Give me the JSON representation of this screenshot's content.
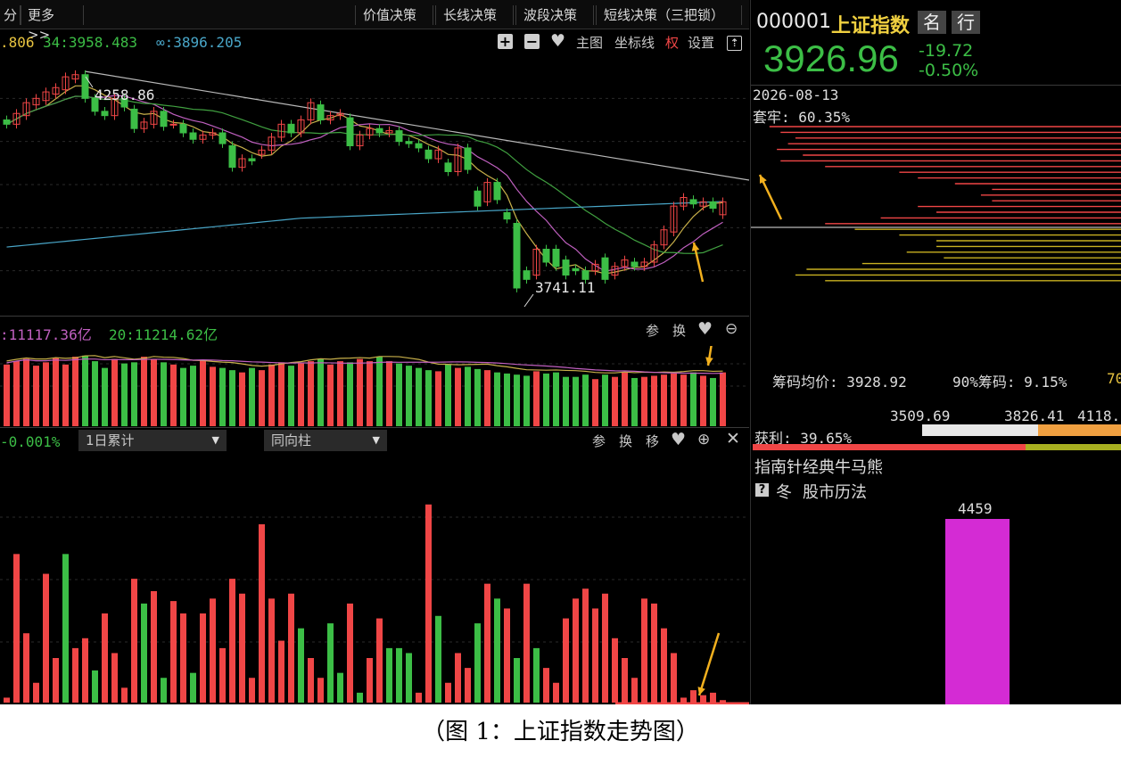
{
  "colors": {
    "up": "#f04646",
    "down": "#3cbe46",
    "bg": "#000000",
    "ma5": "#c8b04a",
    "ma10": "#c060c0",
    "ma20": "#40a040",
    "ma250": "#49a6c8",
    "trend": "#b8b8b8",
    "arrow": "#f2b01e",
    "magenta": "#d42bd4",
    "gold": "#f0d040"
  },
  "toolbar": {
    "left_stub": "分",
    "more_label": "更多>>",
    "tabs": [
      "价值决策",
      "长线决策",
      "波段决策",
      "短线决策（三把锁）"
    ]
  },
  "ma_legend": {
    "a": ".806",
    "b": "34:3958.483",
    "c": "∞:3896.205"
  },
  "chart_tools": {
    "zoom_in": "+",
    "zoom_out": "−",
    "heart": "♥",
    "main": "主图",
    "axis": "坐标线",
    "quan": "权",
    "settings": "设置",
    "export": "⇡"
  },
  "price_labels": {
    "high": "4258.86",
    "low": "3741.11"
  },
  "vol_legend": {
    "a": ":11117.36亿",
    "b": "20:11214.62亿"
  },
  "vol_tools": {
    "can": "参",
    "huan": "换"
  },
  "ind_panel": {
    "value": "-0.001%",
    "select1": "1日累计",
    "select2": "同向柱",
    "can": "参",
    "huan": "换",
    "yi": "移"
  },
  "quote": {
    "code": "000001",
    "name": "上证指数",
    "btn_ming": "名",
    "btn_hang": "行",
    "price": "3926.96",
    "change": "-19.72",
    "pct": "-0.50%"
  },
  "chip": {
    "date": "2026-08-13",
    "trapped": "套牢: 60.35%",
    "avg_label": "筹码均价: 3928.92",
    "ratio90": "90%筹码: 9.15%",
    "ratio70_cut": "70",
    "range_a": "3509.69",
    "range_b": "3826.41",
    "range_c": "4118.",
    "profit": "获利: 39.65%"
  },
  "bull_bear": {
    "title": "指南针经典牛马熊",
    "help": "?",
    "season": "冬",
    "method": "股市历法",
    "bar_value": "4459"
  },
  "caption": "（图 1：上证指数走势图）",
  "chart_data": {
    "type": "candlestick",
    "series": [
      {
        "o": 4150,
        "c": 4140
      },
      {
        "o": 4140,
        "c": 4165
      },
      {
        "o": 4160,
        "c": 4190
      },
      {
        "o": 4185,
        "c": 4200
      },
      {
        "o": 4195,
        "c": 4215
      },
      {
        "o": 4210,
        "c": 4225
      },
      {
        "o": 4220,
        "c": 4250
      },
      {
        "o": 4245,
        "c": 4255
      },
      {
        "o": 4255,
        "c": 4200
      },
      {
        "o": 4200,
        "c": 4170
      },
      {
        "o": 4170,
        "c": 4160
      },
      {
        "o": 4160,
        "c": 4200
      },
      {
        "o": 4200,
        "c": 4180
      },
      {
        "o": 4175,
        "c": 4130
      },
      {
        "o": 4130,
        "c": 4145
      },
      {
        "o": 4140,
        "c": 4170
      },
      {
        "o": 4170,
        "c": 4135
      },
      {
        "o": 4140,
        "c": 4140
      },
      {
        "o": 4140,
        "c": 4120
      },
      {
        "o": 4120,
        "c": 4105
      },
      {
        "o": 4105,
        "c": 4115
      },
      {
        "o": 4115,
        "c": 4120
      },
      {
        "o": 4120,
        "c": 4095
      },
      {
        "o": 4090,
        "c": 4040
      },
      {
        "o": 4040,
        "c": 4060
      },
      {
        "o": 4060,
        "c": 4055
      },
      {
        "o": 4070,
        "c": 4080
      },
      {
        "o": 4080,
        "c": 4110
      },
      {
        "o": 4110,
        "c": 4140
      },
      {
        "o": 4140,
        "c": 4120
      },
      {
        "o": 4120,
        "c": 4150
      },
      {
        "o": 4150,
        "c": 4190
      },
      {
        "o": 4185,
        "c": 4150
      },
      {
        "o": 4150,
        "c": 4160
      },
      {
        "o": 4160,
        "c": 4165
      },
      {
        "o": 4155,
        "c": 4090
      },
      {
        "o": 4090,
        "c": 4115
      },
      {
        "o": 4115,
        "c": 4130
      },
      {
        "o": 4130,
        "c": 4120
      },
      {
        "o": 4120,
        "c": 4125
      },
      {
        "o": 4125,
        "c": 4100
      },
      {
        "o": 4100,
        "c": 4095
      },
      {
        "o": 4095,
        "c": 4085
      },
      {
        "o": 4080,
        "c": 4060
      },
      {
        "o": 4060,
        "c": 4080
      },
      {
        "o": 4050,
        "c": 4030
      },
      {
        "o": 4030,
        "c": 4085
      },
      {
        "o": 4085,
        "c": 4035
      },
      {
        "o": 3985,
        "c": 3950
      },
      {
        "o": 3960,
        "c": 4005
      },
      {
        "o": 4005,
        "c": 3965
      },
      {
        "o": 3935,
        "c": 3920
      },
      {
        "o": 3910,
        "c": 3760
      },
      {
        "o": 3800,
        "c": 3780
      },
      {
        "o": 3790,
        "c": 3850
      },
      {
        "o": 3850,
        "c": 3820
      },
      {
        "o": 3850,
        "c": 3810
      },
      {
        "o": 3825,
        "c": 3790
      },
      {
        "o": 3805,
        "c": 3800
      },
      {
        "o": 3800,
        "c": 3780
      },
      {
        "o": 3800,
        "c": 3815
      },
      {
        "o": 3830,
        "c": 3780
      },
      {
        "o": 3790,
        "c": 3810
      },
      {
        "o": 3810,
        "c": 3825
      },
      {
        "o": 3820,
        "c": 3810
      },
      {
        "o": 3810,
        "c": 3820
      },
      {
        "o": 3820,
        "c": 3860
      },
      {
        "o": 3860,
        "c": 3895
      },
      {
        "o": 3890,
        "c": 3950
      },
      {
        "o": 3950,
        "c": 3970
      },
      {
        "o": 3965,
        "c": 3955
      },
      {
        "o": 3950,
        "c": 3960
      },
      {
        "o": 3960,
        "c": 3945
      },
      {
        "o": 3930,
        "c": 3960
      }
    ],
    "volume": [
      55,
      58,
      60,
      54,
      57,
      61,
      55,
      62,
      63,
      58,
      52,
      60,
      56,
      57,
      62,
      60,
      57,
      55,
      52,
      54,
      59,
      53,
      52,
      50,
      48,
      52,
      50,
      55,
      57,
      54,
      56,
      58,
      60,
      55,
      58,
      57,
      60,
      58,
      62,
      58,
      56,
      54,
      52,
      50,
      49,
      55,
      52,
      53,
      51,
      50,
      48,
      47,
      46,
      45,
      49,
      47,
      48,
      44,
      44,
      46,
      42,
      46,
      44,
      48,
      43,
      44,
      45,
      46,
      47,
      46,
      48,
      45,
      43,
      48
    ],
    "volume_up": [
      true,
      true,
      true,
      true,
      true,
      true,
      true,
      true,
      false,
      false,
      false,
      true,
      false,
      false,
      true,
      true,
      false,
      true,
      false,
      false,
      true,
      true,
      false,
      false,
      true,
      false,
      true,
      true,
      true,
      false,
      true,
      true,
      false,
      true,
      true,
      false,
      true,
      true,
      false,
      true,
      false,
      false,
      false,
      false,
      true,
      false,
      true,
      false,
      false,
      true,
      false,
      false,
      false,
      false,
      true,
      false,
      false,
      false,
      false,
      false,
      true,
      false,
      true,
      true,
      false,
      true,
      true,
      true,
      true,
      true,
      false,
      true,
      false,
      true
    ],
    "indicator": [
      2,
      60,
      28,
      8,
      52,
      18,
      60,
      22,
      26,
      13,
      36,
      20,
      6,
      50,
      40,
      45,
      10,
      41,
      36,
      12,
      36,
      42,
      22,
      50,
      44,
      10,
      72,
      42,
      25,
      44,
      30,
      18,
      10,
      32,
      12,
      40,
      4,
      18,
      34,
      22,
      22,
      20,
      4,
      80,
      35,
      8,
      20,
      14,
      32,
      48,
      42,
      38,
      18,
      48,
      22,
      14,
      8,
      34,
      42,
      46,
      38,
      44,
      26,
      18,
      10,
      42,
      40,
      30,
      20,
      2,
      5,
      3,
      4,
      1
    ],
    "indicator_up": [
      true,
      true,
      true,
      true,
      true,
      true,
      false,
      true,
      true,
      false,
      true,
      true,
      true,
      true,
      false,
      true,
      false,
      true,
      true,
      false,
      true,
      true,
      true,
      true,
      true,
      true,
      true,
      true,
      true,
      true,
      false,
      true,
      true,
      false,
      false,
      true,
      false,
      true,
      true,
      false,
      false,
      false,
      true,
      true,
      false,
      true,
      true,
      true,
      false,
      true,
      false,
      true,
      false,
      true,
      false,
      true,
      true,
      true,
      true,
      true,
      true,
      true,
      true,
      true,
      true,
      true,
      true,
      true,
      true,
      true,
      true,
      true,
      true,
      true
    ],
    "chip_bars": [
      [
        0.95,
        "up"
      ],
      [
        0.92,
        "up"
      ],
      [
        0.88,
        "up"
      ],
      [
        0.9,
        "up"
      ],
      [
        0.93,
        "up"
      ],
      [
        0.86,
        "up"
      ],
      [
        0.92,
        "up"
      ],
      [
        0.8,
        "up"
      ],
      [
        0.6,
        "up"
      ],
      [
        0.55,
        "up"
      ],
      [
        0.45,
        "up"
      ],
      [
        0.35,
        "up"
      ],
      [
        0.38,
        "up"
      ],
      [
        0.35,
        "up"
      ],
      [
        0.55,
        "up"
      ],
      [
        0.5,
        "up"
      ],
      [
        0.65,
        "up"
      ],
      [
        0.8,
        "up"
      ],
      [
        0.72,
        "down"
      ],
      [
        0.6,
        "down"
      ],
      [
        0.5,
        "down"
      ],
      [
        0.5,
        "down"
      ],
      [
        0.58,
        "down"
      ],
      [
        0.48,
        "down"
      ],
      [
        0.7,
        "down"
      ],
      [
        0.85,
        "down"
      ],
      [
        0.88,
        "down"
      ],
      [
        0.8,
        "down"
      ]
    ]
  }
}
